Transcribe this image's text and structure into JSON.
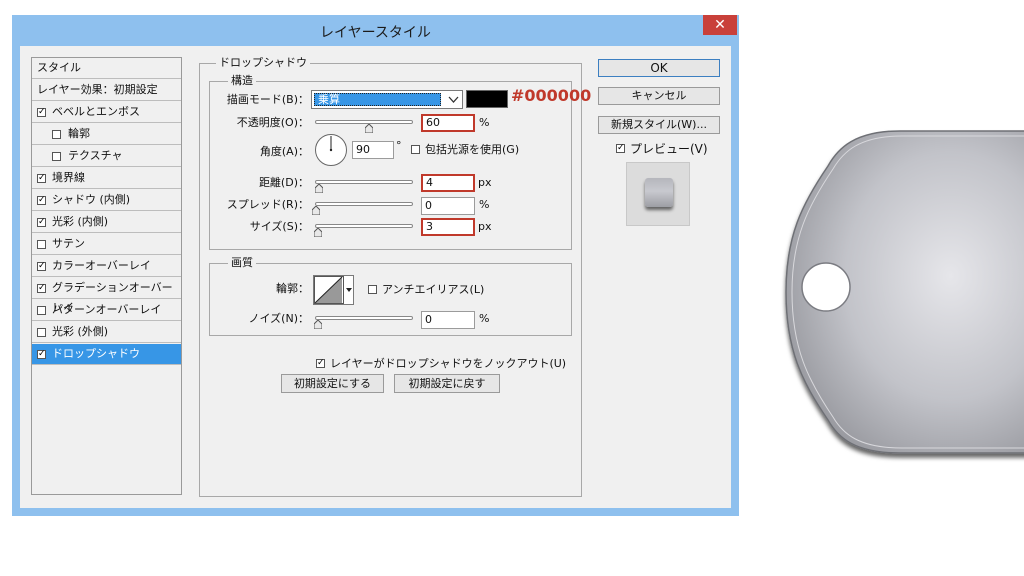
{
  "dialog": {
    "title": "レイヤースタイル",
    "close_glyph": "✕"
  },
  "style_list": {
    "header": "スタイル",
    "items": [
      {
        "label": "レイヤー効果：初期設定",
        "checkbox": false,
        "checked": false,
        "indent": false,
        "selected": false
      },
      {
        "label": "ベベルとエンボス",
        "checkbox": true,
        "checked": true,
        "indent": false,
        "selected": false
      },
      {
        "label": "輪郭",
        "checkbox": true,
        "checked": false,
        "indent": true,
        "selected": false
      },
      {
        "label": "テクスチャ",
        "checkbox": true,
        "checked": false,
        "indent": true,
        "selected": false
      },
      {
        "label": "境界線",
        "checkbox": true,
        "checked": true,
        "indent": false,
        "selected": false
      },
      {
        "label": "シャドウ (内側)",
        "checkbox": true,
        "checked": true,
        "indent": false,
        "selected": false
      },
      {
        "label": "光彩 (内側)",
        "checkbox": true,
        "checked": true,
        "indent": false,
        "selected": false
      },
      {
        "label": "サテン",
        "checkbox": true,
        "checked": false,
        "indent": false,
        "selected": false
      },
      {
        "label": "カラーオーバーレイ",
        "checkbox": true,
        "checked": true,
        "indent": false,
        "selected": false
      },
      {
        "label": "グラデーションオーバーレイ",
        "checkbox": true,
        "checked": true,
        "indent": false,
        "selected": false
      },
      {
        "label": "パターンオーバーレイ",
        "checkbox": true,
        "checked": false,
        "indent": false,
        "selected": false
      },
      {
        "label": "光彩 (外側)",
        "checkbox": true,
        "checked": false,
        "indent": false,
        "selected": false
      },
      {
        "label": "ドロップシャドウ",
        "checkbox": true,
        "checked": true,
        "indent": false,
        "selected": true
      }
    ]
  },
  "drop_shadow": {
    "section_title": "ドロップシャドウ",
    "structure": {
      "title": "構造",
      "blend_mode_label": "描画モード(B)：",
      "blend_mode_value": "乗算",
      "color_value": "#000000",
      "color_annotation": "#000000",
      "opacity_label": "不透明度(O)：",
      "opacity_value": "60",
      "opacity_fraction": 0.6,
      "opacity_unit": "%",
      "angle_label": "角度(A)：",
      "angle_value": "90",
      "angle_unit": "°",
      "global_light_label": "包括光源を使用(G)",
      "global_light_checked": false,
      "distance_label": "距離(D)：",
      "distance_value": "4",
      "distance_unit": "px",
      "spread_label": "スプレッド(R)：",
      "spread_value": "0",
      "spread_unit": "%",
      "size_label": "サイズ(S)：",
      "size_value": "3",
      "size_unit": "px"
    },
    "quality": {
      "title": "画質",
      "contour_label": "輪郭：",
      "antialias_label": "アンチエイリアス(L)",
      "antialias_checked": false,
      "noise_label": "ノイズ(N)：",
      "noise_value": "0",
      "noise_unit": "%"
    },
    "knockout_label": "レイヤーがドロップシャドウをノックアウト(U)",
    "knockout_checked": true,
    "make_default_label": "初期設定にする",
    "reset_default_label": "初期設定に戻す"
  },
  "buttons": {
    "ok": "OK",
    "cancel": "キャンセル",
    "new_style": "新規スタイル(W)...",
    "preview_label": "プレビュー(V)",
    "preview_checked": true
  },
  "colors": {
    "titlebar": "#8ec0ee",
    "selected": "#3796e6",
    "annotation_red": "#c0392b",
    "close": "#c9403a"
  }
}
